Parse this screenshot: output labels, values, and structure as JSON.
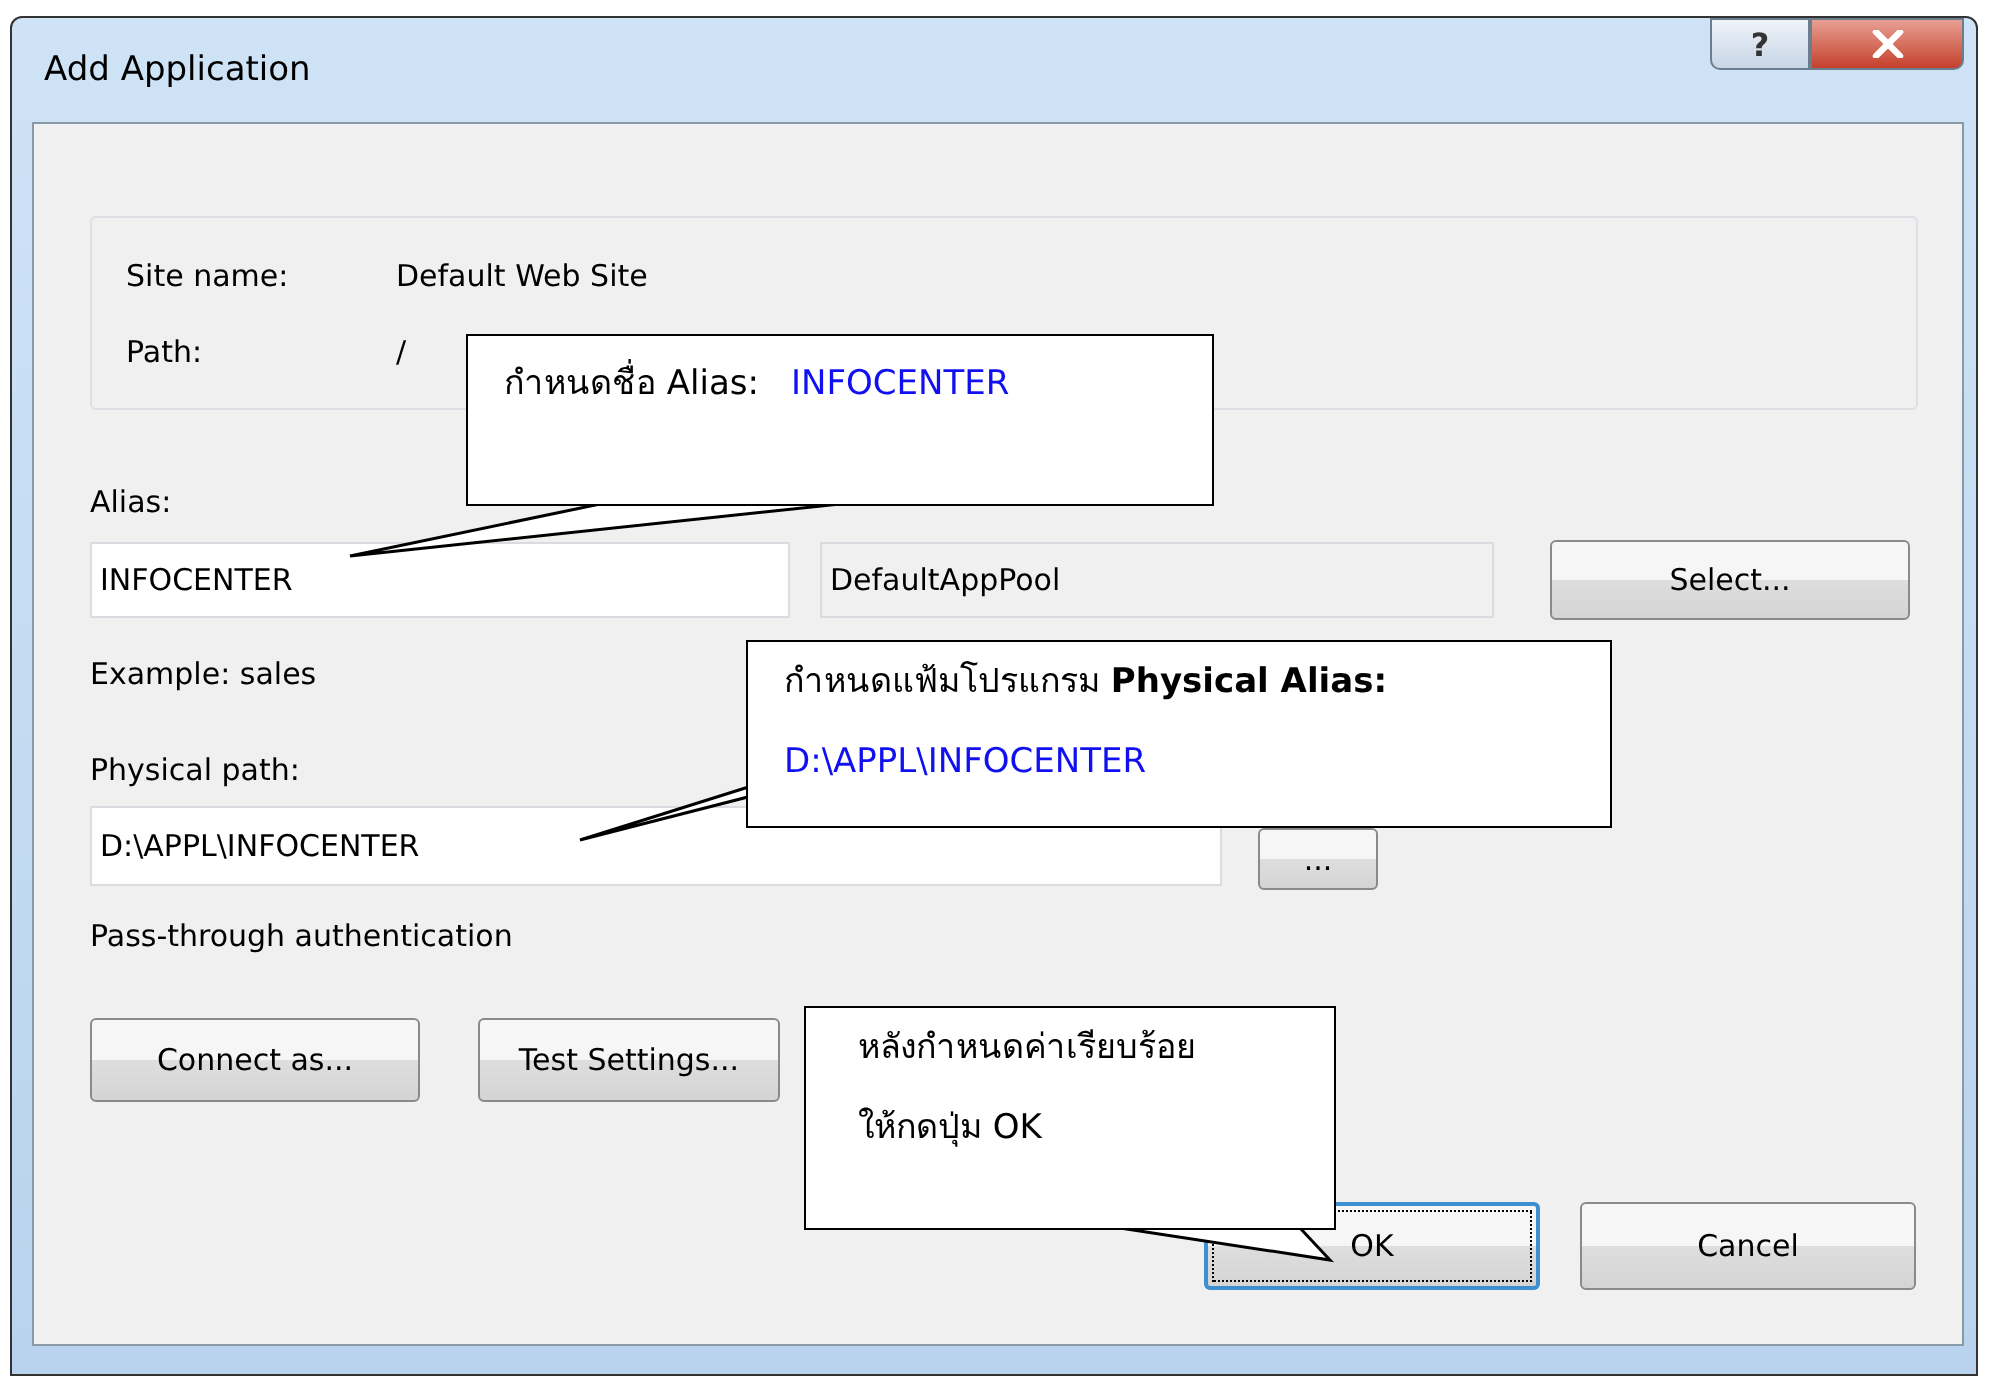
{
  "window": {
    "title": "Add Application",
    "help_label": "?"
  },
  "site_info": [
    {
      "label": "Site name:",
      "value": "Default Web Site"
    },
    {
      "label": "Path:",
      "value": "/"
    }
  ],
  "alias": {
    "label": "Alias:",
    "value": "INFOCENTER"
  },
  "application_pool": {
    "value": "DefaultAppPool",
    "disabled": true
  },
  "select_button": {
    "label": "Select..."
  },
  "example": "Example: sales",
  "physical_path": {
    "label": "Physical path:",
    "value": "D:\\APPL\\INFOCENTER"
  },
  "browse_button": {
    "label": "..."
  },
  "authentication": "Pass-through authentication",
  "buttons": [
    {
      "label": "Connect as..."
    },
    {
      "label": "Test Settings..."
    }
  ],
  "dialog_buttons": [
    {
      "label": "OK",
      "selected": true
    },
    {
      "label": "Cancel",
      "selected": false
    }
  ],
  "callouts": [
    {
      "lines": [
        {
          "text": "กำหนดชื่อ Alias:",
          "value": "INFOCENTER"
        }
      ]
    },
    {
      "lines": [
        {
          "text": "กำหนดแฟ้มโปรแกรม **Physical Alias:**"
        },
        {
          "value": "D:\\APPL\\INFOCENTER"
        }
      ]
    },
    {
      "lines": [
        {
          "text": "หลังกำหนดค่าเรียบร้อย"
        },
        {
          "text": "ให้กดปุ่ม OK"
        }
      ]
    }
  ]
}
